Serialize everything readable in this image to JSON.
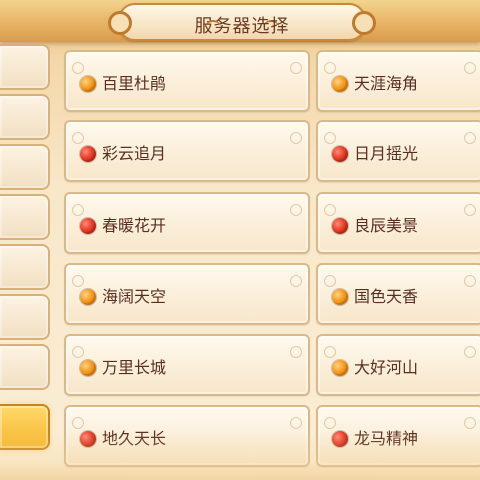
{
  "header": {
    "title": "服务器选择"
  },
  "tabs": [
    {
      "active": false
    },
    {
      "active": false
    },
    {
      "active": false
    },
    {
      "active": false
    },
    {
      "active": false
    },
    {
      "active": false
    },
    {
      "active": false
    },
    {
      "active": true
    }
  ],
  "servers": {
    "left": [
      {
        "name": "百里杜鹃",
        "status": "orange"
      },
      {
        "name": "彩云追月",
        "status": "red"
      },
      {
        "name": "春暖花开",
        "status": "red"
      },
      {
        "name": "海阔天空",
        "status": "orange"
      },
      {
        "name": "万里长城",
        "status": "orange"
      },
      {
        "name": "地久天长",
        "status": "red"
      }
    ],
    "right": [
      {
        "name": "天涯海角",
        "status": "orange"
      },
      {
        "name": "日月摇光",
        "status": "red"
      },
      {
        "name": "良辰美景",
        "status": "red"
      },
      {
        "name": "国色天香",
        "status": "orange"
      },
      {
        "name": "大好河山",
        "status": "orange"
      },
      {
        "name": "龙马精神",
        "status": "red"
      }
    ]
  }
}
